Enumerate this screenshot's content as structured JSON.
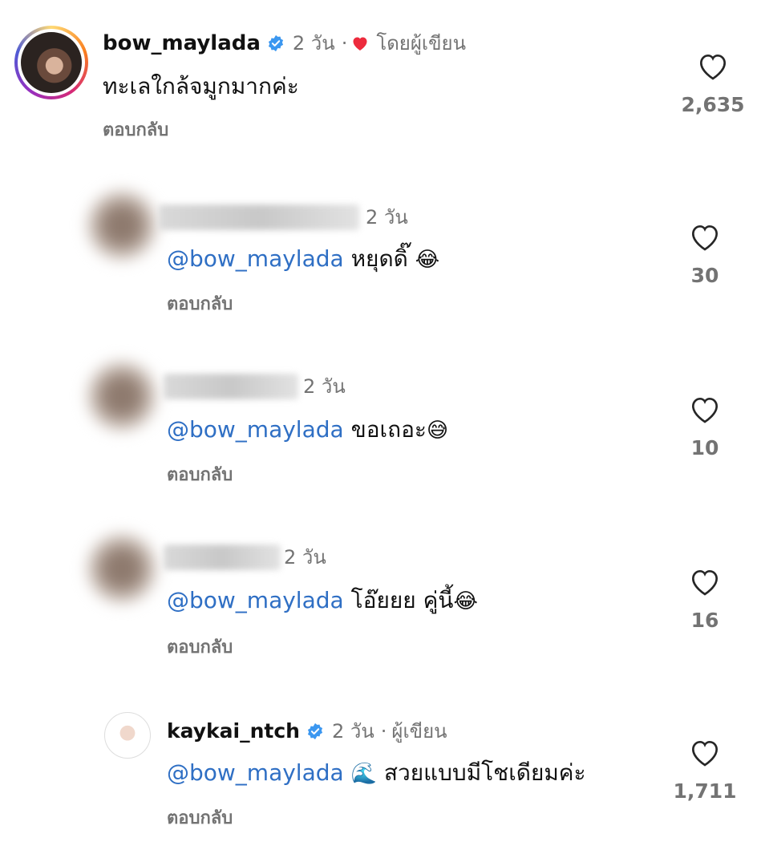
{
  "comments": [
    {
      "username": "bow_maylada",
      "time": "2 วัน",
      "dot": "·",
      "liked_by_author": "โดยผู้เขียน",
      "text": "ทะเลใกล้จมูกมากค่ะ",
      "reply_label": "ตอบกลับ",
      "likes": "2,635"
    },
    {
      "time": "2 วัน",
      "mention": "@bow_maylada",
      "text": "หยุดดิ๊",
      "emoji": "😂",
      "reply_label": "ตอบกลับ",
      "likes": "30"
    },
    {
      "time": "2 วัน",
      "mention": "@bow_maylada",
      "text": "ขอเถอะ",
      "emoji": "😅",
      "reply_label": "ตอบกลับ",
      "likes": "10"
    },
    {
      "time": "2 วัน",
      "mention": "@bow_maylada",
      "text": "โอ๊ยยย คู่นี้",
      "emoji": "😂",
      "reply_label": "ตอบกลับ",
      "likes": "16"
    },
    {
      "username": "kaykai_ntch",
      "time": "2 วัน",
      "dot": "·",
      "author_label": "ผู้เขียน",
      "mention": "@bow_maylada",
      "emoji": "🌊",
      "text": "สวยแบบมีโชเดียมค่ะ",
      "reply_label": "ตอบกลับ",
      "likes": "1,711"
    }
  ],
  "icons": {
    "verified": "verified-badge-icon",
    "heart_filled": "heart-filled-icon",
    "heart_outline": "heart-outline-icon"
  },
  "colors": {
    "mention": "#2f6fc4",
    "verified": "#3b97f0",
    "heart": "#ed2b3d",
    "muted": "#737373"
  }
}
